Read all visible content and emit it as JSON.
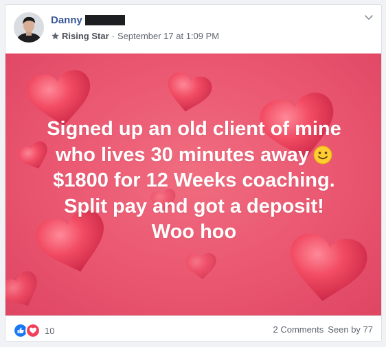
{
  "post": {
    "author": {
      "name": "Danny"
    },
    "meta": {
      "badge_label": "Rising Star",
      "separator": "·",
      "timestamp": "September 17 at 1:09 PM"
    },
    "banner": {
      "lines": [
        "Signed up an old client of mine",
        "who lives 30 minutes away",
        "$1800 for 12 Weeks coaching.",
        "Split pay and got a deposit!",
        "Woo hoo"
      ],
      "background_color": "#e9546d",
      "text_color": "#ffffff",
      "emoji_name": "slightly-smiling-face-icon"
    },
    "footer": {
      "reaction_count": "10",
      "comments_label": "2 Comments",
      "seen_by_label": "Seen by 77"
    },
    "colors": {
      "author_link": "#385898",
      "meta_text": "#606770",
      "like_blue": "#1877f2",
      "love_red": "#f33e58"
    }
  }
}
